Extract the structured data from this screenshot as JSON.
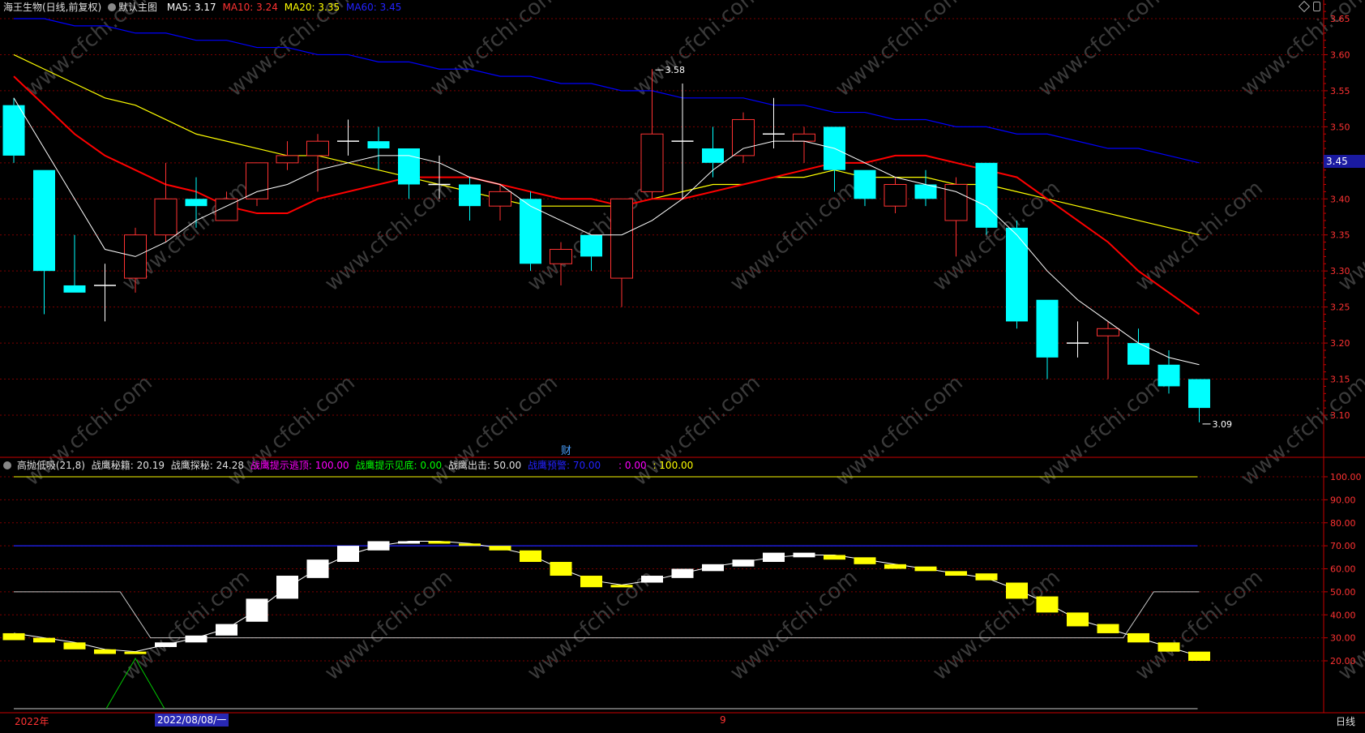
{
  "header_main": {
    "stock": "海王生物(日线,前复权)",
    "template": "默认主图",
    "ma5": "MA5: 3.17",
    "ma10": "MA10: 3.24",
    "ma20": "MA20: 3.35",
    "ma60": "MA60: 3.45",
    "price_tag": "3.45"
  },
  "header_sub": {
    "title": "高抛低吸(21,8)",
    "mijie": "战鹰秘籍: 20.19",
    "tanmi": "战鹰探秘: 24.28",
    "tishi_top": "战鹰提示逃顶: 100.00",
    "tishi_bottom": "战鹰提示见底: 0.00",
    "chuji": "战鹰出击: 50.00",
    "yujing": "战鹰预警: 70.00",
    "extra1": ": 0.00",
    "extra2": ": 100.00"
  },
  "footer": {
    "year": "2022年",
    "date": "2022/08/08/一",
    "month_mark": "9",
    "period": "日线"
  },
  "watermark": "www.cfchi.com",
  "fin_marker": "财",
  "colors": {
    "up": "#ff3232",
    "down": "#00ffff",
    "ma5": "#ffffff",
    "ma10": "#ff0000",
    "ma20": "#ffff00",
    "ma60": "#0000ff",
    "axis": "#c80000",
    "grid": "#7d0000"
  },
  "chart_data": [
    {
      "type": "candlestick",
      "ylim": [
        3.08,
        3.66
      ],
      "yticks": [
        3.1,
        3.15,
        3.2,
        3.25,
        3.3,
        3.35,
        3.4,
        3.45,
        3.5,
        3.55,
        3.6,
        3.65
      ],
      "annotations": [
        {
          "label": "3.58",
          "index": 21
        },
        {
          "label": "3.09",
          "index": 39
        }
      ],
      "candles": [
        {
          "o": 3.53,
          "c": 3.46,
          "h": 3.54,
          "l": 3.45
        },
        {
          "o": 3.44,
          "c": 3.3,
          "h": 3.44,
          "l": 3.24
        },
        {
          "o": 3.28,
          "c": 3.27,
          "h": 3.35,
          "l": 3.27
        },
        {
          "o": 3.28,
          "c": 3.28,
          "h": 3.31,
          "l": 3.23
        },
        {
          "o": 3.29,
          "c": 3.35,
          "h": 3.36,
          "l": 3.27
        },
        {
          "o": 3.35,
          "c": 3.4,
          "h": 3.45,
          "l": 3.34
        },
        {
          "o": 3.4,
          "c": 3.39,
          "h": 3.43,
          "l": 3.36
        },
        {
          "o": 3.37,
          "c": 3.4,
          "h": 3.41,
          "l": 3.37
        },
        {
          "o": 3.4,
          "c": 3.45,
          "h": 3.45,
          "l": 3.39
        },
        {
          "o": 3.45,
          "c": 3.46,
          "h": 3.48,
          "l": 3.44
        },
        {
          "o": 3.46,
          "c": 3.48,
          "h": 3.49,
          "l": 3.41
        },
        {
          "o": 3.48,
          "c": 3.48,
          "h": 3.51,
          "l": 3.46
        },
        {
          "o": 3.48,
          "c": 3.47,
          "h": 3.5,
          "l": 3.44
        },
        {
          "o": 3.47,
          "c": 3.42,
          "h": 3.47,
          "l": 3.4
        },
        {
          "o": 3.42,
          "c": 3.42,
          "h": 3.46,
          "l": 3.4
        },
        {
          "o": 3.42,
          "c": 3.39,
          "h": 3.43,
          "l": 3.37
        },
        {
          "o": 3.39,
          "c": 3.41,
          "h": 3.42,
          "l": 3.37
        },
        {
          "o": 3.4,
          "c": 3.31,
          "h": 3.41,
          "l": 3.3
        },
        {
          "o": 3.31,
          "c": 3.33,
          "h": 3.34,
          "l": 3.28
        },
        {
          "o": 3.35,
          "c": 3.32,
          "h": 3.35,
          "l": 3.3
        },
        {
          "o": 3.29,
          "c": 3.4,
          "h": 3.4,
          "l": 3.25
        },
        {
          "o": 3.41,
          "c": 3.49,
          "h": 3.58,
          "l": 3.4
        },
        {
          "o": 3.48,
          "c": 3.48,
          "h": 3.56,
          "l": 3.4
        },
        {
          "o": 3.47,
          "c": 3.45,
          "h": 3.5,
          "l": 3.43
        },
        {
          "o": 3.46,
          "c": 3.51,
          "h": 3.52,
          "l": 3.45
        },
        {
          "o": 3.49,
          "c": 3.49,
          "h": 3.54,
          "l": 3.47
        },
        {
          "o": 3.48,
          "c": 3.49,
          "h": 3.5,
          "l": 3.45
        },
        {
          "o": 3.5,
          "c": 3.44,
          "h": 3.5,
          "l": 3.41
        },
        {
          "o": 3.44,
          "c": 3.4,
          "h": 3.44,
          "l": 3.39
        },
        {
          "o": 3.39,
          "c": 3.42,
          "h": 3.43,
          "l": 3.38
        },
        {
          "o": 3.42,
          "c": 3.4,
          "h": 3.44,
          "l": 3.39
        },
        {
          "o": 3.37,
          "c": 3.42,
          "h": 3.43,
          "l": 3.32
        },
        {
          "o": 3.45,
          "c": 3.36,
          "h": 3.45,
          "l": 3.35
        },
        {
          "o": 3.36,
          "c": 3.23,
          "h": 3.37,
          "l": 3.22
        },
        {
          "o": 3.26,
          "c": 3.18,
          "h": 3.26,
          "l": 3.15
        },
        {
          "o": 3.2,
          "c": 3.2,
          "h": 3.23,
          "l": 3.18
        },
        {
          "o": 3.21,
          "c": 3.22,
          "h": 3.23,
          "l": 3.15
        },
        {
          "o": 3.2,
          "c": 3.17,
          "h": 3.22,
          "l": 3.17
        },
        {
          "o": 3.17,
          "c": 3.14,
          "h": 3.19,
          "l": 3.13
        },
        {
          "o": 3.15,
          "c": 3.11,
          "h": 3.15,
          "l": 3.09
        }
      ],
      "ma5": [
        3.54,
        3.47,
        3.4,
        3.33,
        3.32,
        3.34,
        3.37,
        3.39,
        3.41,
        3.42,
        3.44,
        3.45,
        3.46,
        3.46,
        3.45,
        3.43,
        3.42,
        3.39,
        3.37,
        3.35,
        3.35,
        3.37,
        3.4,
        3.44,
        3.47,
        3.48,
        3.48,
        3.47,
        3.45,
        3.43,
        3.42,
        3.41,
        3.39,
        3.35,
        3.3,
        3.26,
        3.23,
        3.2,
        3.18,
        3.17
      ],
      "ma10": [
        3.57,
        3.53,
        3.49,
        3.46,
        3.44,
        3.42,
        3.41,
        3.39,
        3.38,
        3.38,
        3.4,
        3.41,
        3.42,
        3.43,
        3.43,
        3.43,
        3.42,
        3.41,
        3.4,
        3.4,
        3.39,
        3.4,
        3.4,
        3.41,
        3.42,
        3.43,
        3.44,
        3.45,
        3.45,
        3.46,
        3.46,
        3.45,
        3.44,
        3.43,
        3.4,
        3.37,
        3.34,
        3.3,
        3.27,
        3.24
      ],
      "ma20": [
        3.6,
        3.58,
        3.56,
        3.54,
        3.53,
        3.51,
        3.49,
        3.48,
        3.47,
        3.46,
        3.46,
        3.45,
        3.44,
        3.43,
        3.42,
        3.41,
        3.4,
        3.39,
        3.39,
        3.39,
        3.39,
        3.4,
        3.41,
        3.42,
        3.42,
        3.43,
        3.43,
        3.44,
        3.43,
        3.43,
        3.43,
        3.42,
        3.42,
        3.41,
        3.4,
        3.39,
        3.38,
        3.37,
        3.36,
        3.35
      ],
      "ma60": [
        3.65,
        3.65,
        3.64,
        3.64,
        3.63,
        3.63,
        3.62,
        3.62,
        3.61,
        3.61,
        3.6,
        3.6,
        3.59,
        3.59,
        3.58,
        3.58,
        3.57,
        3.57,
        3.56,
        3.56,
        3.55,
        3.55,
        3.54,
        3.54,
        3.54,
        3.53,
        3.53,
        3.52,
        3.52,
        3.51,
        3.51,
        3.5,
        3.5,
        3.49,
        3.49,
        3.48,
        3.47,
        3.47,
        3.46,
        3.45
      ]
    },
    {
      "type": "bar",
      "title": "高抛低吸(21,8)",
      "ylim": [
        0,
        105
      ],
      "yticks": [
        20,
        30,
        40,
        50,
        60,
        70,
        80,
        90,
        100
      ],
      "bars": [
        {
          "a": 32,
          "b": 29,
          "color": "yellow"
        },
        {
          "a": 30,
          "b": 28,
          "color": "yellow"
        },
        {
          "a": 28,
          "b": 25,
          "color": "yellow"
        },
        {
          "a": 25,
          "b": 23,
          "color": "yellow"
        },
        {
          "a": 24,
          "b": 23,
          "color": "yellow"
        },
        {
          "a": 26,
          "b": 28,
          "color": "white"
        },
        {
          "a": 28,
          "b": 31,
          "color": "white"
        },
        {
          "a": 31,
          "b": 36,
          "color": "white"
        },
        {
          "a": 37,
          "b": 47,
          "color": "white"
        },
        {
          "a": 47,
          "b": 57,
          "color": "white"
        },
        {
          "a": 56,
          "b": 64,
          "color": "white"
        },
        {
          "a": 63,
          "b": 70,
          "color": "white"
        },
        {
          "a": 68,
          "b": 72,
          "color": "white"
        },
        {
          "a": 71,
          "b": 72,
          "color": "white"
        },
        {
          "a": 72,
          "b": 71,
          "color": "yellow"
        },
        {
          "a": 71,
          "b": 70,
          "color": "yellow"
        },
        {
          "a": 70,
          "b": 68,
          "color": "yellow"
        },
        {
          "a": 68,
          "b": 63,
          "color": "yellow"
        },
        {
          "a": 63,
          "b": 57,
          "color": "yellow"
        },
        {
          "a": 57,
          "b": 52,
          "color": "yellow"
        },
        {
          "a": 53,
          "b": 52,
          "color": "yellow"
        },
        {
          "a": 54,
          "b": 57,
          "color": "white"
        },
        {
          "a": 56,
          "b": 60,
          "color": "white"
        },
        {
          "a": 59,
          "b": 62,
          "color": "white"
        },
        {
          "a": 61,
          "b": 64,
          "color": "white"
        },
        {
          "a": 63,
          "b": 67,
          "color": "white"
        },
        {
          "a": 65,
          "b": 67,
          "color": "white"
        },
        {
          "a": 66,
          "b": 64,
          "color": "yellow"
        },
        {
          "a": 65,
          "b": 62,
          "color": "yellow"
        },
        {
          "a": 62,
          "b": 60,
          "color": "yellow"
        },
        {
          "a": 61,
          "b": 59,
          "color": "yellow"
        },
        {
          "a": 59,
          "b": 57,
          "color": "yellow"
        },
        {
          "a": 58,
          "b": 55,
          "color": "yellow"
        },
        {
          "a": 54,
          "b": 47,
          "color": "yellow"
        },
        {
          "a": 48,
          "b": 41,
          "color": "yellow"
        },
        {
          "a": 41,
          "b": 35,
          "color": "yellow"
        },
        {
          "a": 36,
          "b": 32,
          "color": "yellow"
        },
        {
          "a": 32,
          "b": 28,
          "color": "yellow"
        },
        {
          "a": 28,
          "b": 24,
          "color": "yellow"
        },
        {
          "a": 24,
          "b": 20,
          "color": "yellow"
        }
      ],
      "trend_line": [
        32,
        30,
        28,
        25,
        24,
        27,
        30,
        34,
        42,
        52,
        60,
        66,
        70,
        72,
        72,
        71,
        69,
        66,
        60,
        55,
        53,
        55,
        58,
        61,
        63,
        65,
        66,
        66,
        64,
        62,
        60,
        58,
        56,
        51,
        45,
        38,
        34,
        30,
        26,
        22
      ],
      "chuji_line": [
        50,
        50,
        50,
        50,
        30,
        30,
        30,
        30,
        30,
        30,
        30,
        30,
        30,
        30,
        30,
        30,
        30,
        30,
        30,
        30,
        30,
        30,
        30,
        30,
        30,
        30,
        30,
        30,
        30,
        30,
        30,
        30,
        30,
        30,
        30,
        30,
        30,
        30,
        50,
        50
      ],
      "signal_line": [
        0,
        0,
        0,
        0,
        20,
        0,
        0,
        0,
        0,
        0,
        0,
        0,
        0,
        0,
        0,
        0,
        0,
        0,
        0,
        0,
        0,
        0,
        0,
        0,
        0,
        0,
        0,
        0,
        0,
        0,
        0,
        0,
        0,
        0,
        0,
        0,
        0,
        0,
        0,
        0
      ],
      "top_line": 100,
      "warn_line": 70
    }
  ]
}
